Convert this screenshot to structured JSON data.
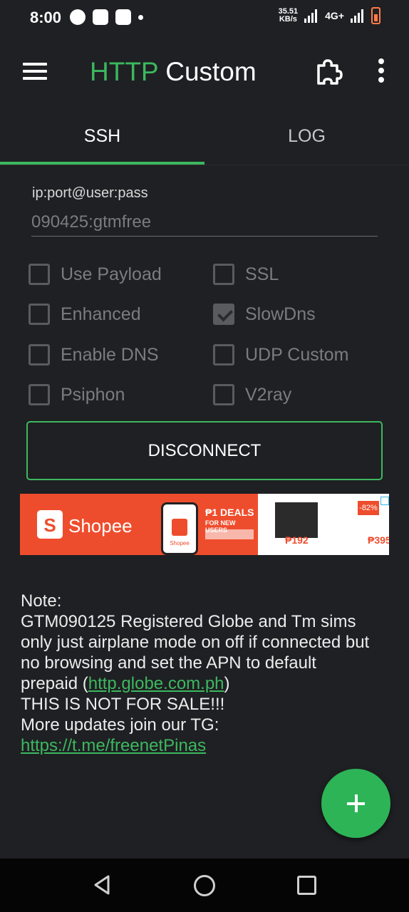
{
  "status_bar": {
    "time": "8:00",
    "speed_value": "35.51",
    "speed_unit": "KB/s",
    "network": "4G+"
  },
  "app": {
    "title_part1": "HTTP",
    "title_part2": "Custom"
  },
  "tabs": [
    {
      "label": "SSH",
      "active": true
    },
    {
      "label": "LOG",
      "active": false
    }
  ],
  "form": {
    "label": "ip:port@user:pass",
    "value": "090425:gtmfree"
  },
  "options": [
    {
      "label": "Use Payload",
      "checked": false
    },
    {
      "label": "SSL",
      "checked": false
    },
    {
      "label": "Enhanced",
      "checked": false
    },
    {
      "label": "SlowDns",
      "checked": true
    },
    {
      "label": "Enable DNS",
      "checked": false
    },
    {
      "label": "UDP Custom",
      "checked": false
    },
    {
      "label": "Psiphon",
      "checked": false
    },
    {
      "label": "V2ray",
      "checked": false
    }
  ],
  "disconnect_label": "DISCONNECT",
  "ad": {
    "brand": "Shopee",
    "phone_brand": "Shopee",
    "deal_title": "₱1 DEALS",
    "deal_sub": "FOR NEW USERS",
    "price1": "₱192",
    "discount": "-82%",
    "price2": "₱395"
  },
  "note": {
    "heading": "Note:",
    "line1": "GTM090125 Registered Globe and Tm sims only just airplane mode on off if connected but no browsing and set the APN to default prepaid (",
    "link1": "http.globe.com.ph",
    "line1_end": ")",
    "line2": "THIS IS NOT FOR SALE!!!",
    "line3": "More updates join our TG: ",
    "link2": "https://t.me/freenetPinas"
  },
  "colors": {
    "accent": "#3cb85f",
    "background": "#1f2023",
    "shopee": "#ee4d2d"
  }
}
